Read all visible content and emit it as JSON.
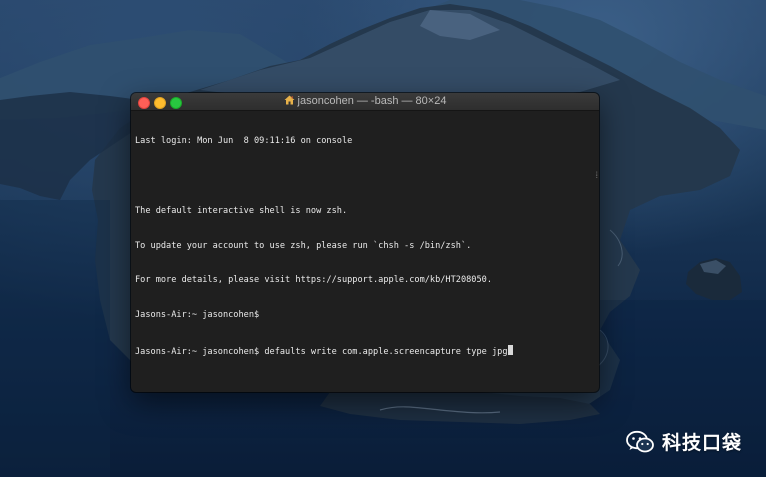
{
  "window": {
    "title": "jasoncohen — -bash — 80×24"
  },
  "terminal": {
    "lines": [
      "Last login: Mon Jun  8 09:11:16 on console",
      "",
      "The default interactive shell is now zsh.",
      "To update your account to use zsh, please run `chsh -s /bin/zsh`.",
      "For more details, please visit https://support.apple.com/kb/HT208050.",
      "Jasons-Air:~ jasoncohen$",
      "Jasons-Air:~ jasoncohen$ defaults write com.apple.screencapture type jpg"
    ]
  },
  "watermark": {
    "text": "科技口袋",
    "icon": "wechat-icon"
  },
  "icons": {
    "title_icon": "home-icon"
  },
  "colors": {
    "close": "#fe5f57",
    "minimize": "#febc2e",
    "maximize": "#28c840",
    "terminal_bg": "#1f1f1f",
    "terminal_text": "#eaeaea"
  }
}
